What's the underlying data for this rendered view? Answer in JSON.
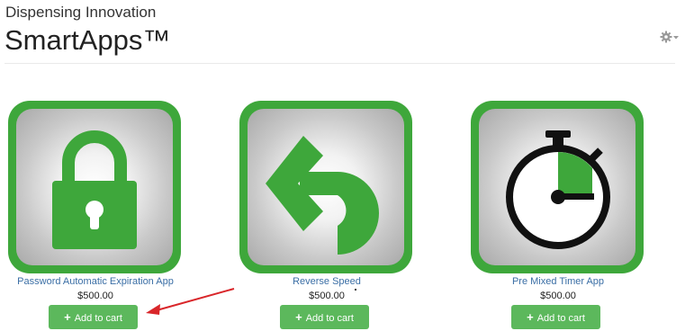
{
  "header": {
    "company": "Dispensing Innovation",
    "title": "SmartApps™",
    "settings_icon": "gear-icon"
  },
  "apps": [
    {
      "name": "Password Automatic Expiration App",
      "price": "$500.00",
      "icon": "lock-icon",
      "cart_label": "Add to cart"
    },
    {
      "name": "Reverse Speed",
      "price": "$500.00",
      "icon": "reverse-arrow-icon",
      "cart_label": "Add to cart"
    },
    {
      "name": "Pre Mixed Timer App",
      "price": "$500.00",
      "icon": "stopwatch-icon",
      "cart_label": "Add to cart"
    }
  ],
  "colors": {
    "brand_green": "#3ea73b",
    "button_green": "#5cb85c",
    "link_blue": "#3a6ea5",
    "annotation_red": "#d9262a"
  }
}
